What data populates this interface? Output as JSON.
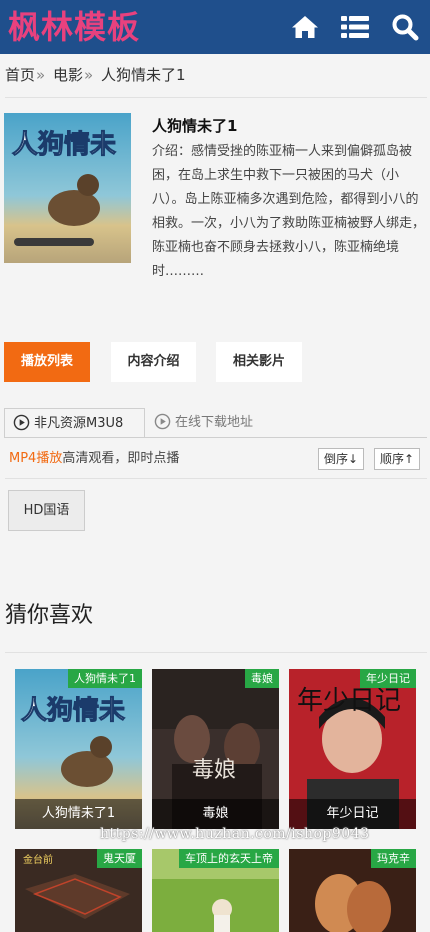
{
  "header": {
    "logo": "枫林模板",
    "icons": [
      "home-icon",
      "list-icon",
      "search-icon"
    ],
    "bg_color": "#1f4f8c",
    "logo_color": "#e8417e"
  },
  "breadcrumb": {
    "home": "首页",
    "sep": "»",
    "category": "电影",
    "current": "人狗情未了1"
  },
  "movie": {
    "title": "人狗情未了1",
    "description": "介绍：感情受挫的陈亚楠一人来到偏僻孤岛被困，在岛上求生中救下一只被困的马犬（小八）。岛上陈亚楠多次遇到危险，都得到小八的相救。一次，小八为了救助陈亚楠被野人绑走，陈亚楠也奋不顾身去拯救小八，陈亚楠绝境时………",
    "poster_text": "人狗情未"
  },
  "tabs": [
    {
      "label": "播放列表",
      "active": true
    },
    {
      "label": "内容介绍",
      "active": false
    },
    {
      "label": "相关影片",
      "active": false
    }
  ],
  "sources": [
    {
      "label": "非凡资源M3U8",
      "active": true
    },
    {
      "label": "在线下载地址",
      "active": false
    }
  ],
  "playinfo": {
    "highlight": "MP4播放",
    "text": "高清观看，即时点播",
    "desc_btn": "倒序↓",
    "asc_btn": "顺序↑"
  },
  "episodes": [
    "HD国语"
  ],
  "accent_color": "#f26a12",
  "recommend": {
    "title": "猜你喜欢",
    "items": [
      {
        "badge": "人狗情未了1",
        "caption": "人狗情未了1",
        "poster_text": "人狗情未"
      },
      {
        "badge": "毒娘",
        "caption": "毒娘",
        "poster_text": "毒娘"
      },
      {
        "badge": "年少日记",
        "caption": "年少日记",
        "poster_text": "年少日记"
      },
      {
        "badge": "鬼天厦",
        "caption": "",
        "poster_text": "金台前"
      },
      {
        "badge": "车顶上的玄天上帝",
        "caption": "",
        "poster_text": ""
      },
      {
        "badge": "玛克辛",
        "caption": "",
        "poster_text": ""
      }
    ]
  },
  "watermark": "https://www.huzhan.com/ishop9043"
}
